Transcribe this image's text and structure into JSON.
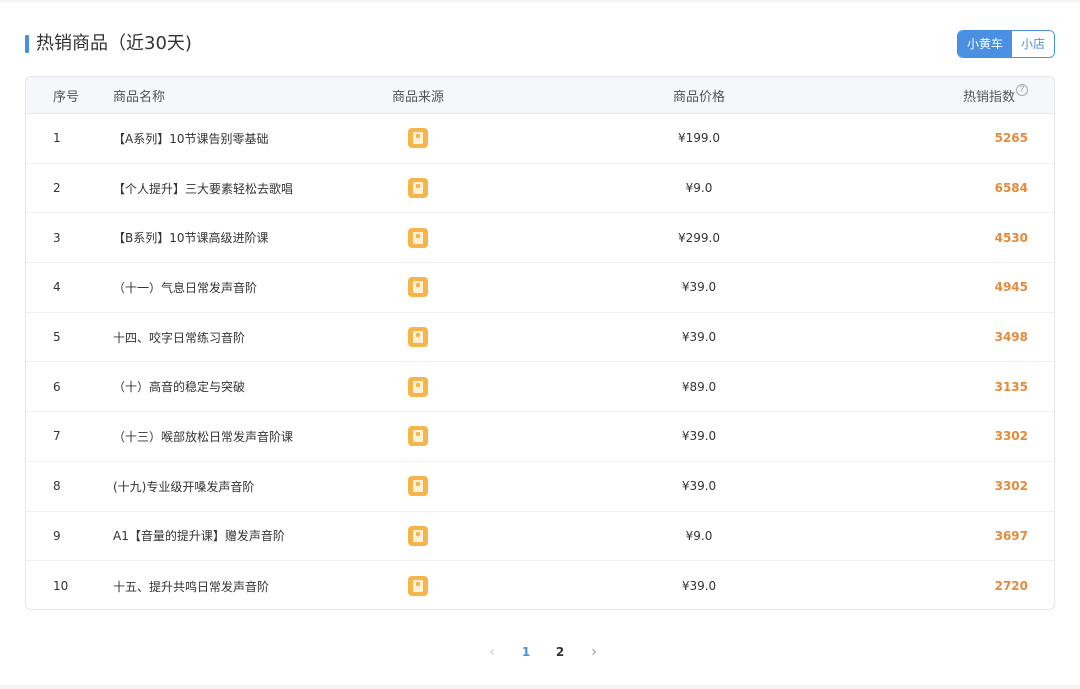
{
  "header": {
    "title": "热销商品（近30天)"
  },
  "toggle": {
    "options": [
      "小黄车",
      "小店"
    ],
    "selected": "小黄车"
  },
  "table": {
    "columns": {
      "index": "序号",
      "name": "商品名称",
      "source": "商品来源",
      "price": "商品价格",
      "heat": "热销指数"
    },
    "rows": [
      {
        "index": "1",
        "name": "【A系列】10节课告别零基础",
        "source_icon": "product-source-icon",
        "price": "¥199.0",
        "heat": "5265"
      },
      {
        "index": "2",
        "name": "【个人提升】三大要素轻松去歌唱",
        "source_icon": "product-source-icon",
        "price": "¥9.0",
        "heat": "6584"
      },
      {
        "index": "3",
        "name": "【B系列】10节课高级进阶课",
        "source_icon": "product-source-icon",
        "price": "¥299.0",
        "heat": "4530"
      },
      {
        "index": "4",
        "name": "（十一）气息日常发声音阶",
        "source_icon": "product-source-icon",
        "price": "¥39.0",
        "heat": "4945"
      },
      {
        "index": "5",
        "name": "十四、咬字日常练习音阶",
        "source_icon": "product-source-icon",
        "price": "¥39.0",
        "heat": "3498"
      },
      {
        "index": "6",
        "name": "（十）高音的稳定与突破",
        "source_icon": "product-source-icon",
        "price": "¥89.0",
        "heat": "3135"
      },
      {
        "index": "7",
        "name": "（十三）喉部放松日常发声音阶课",
        "source_icon": "product-source-icon",
        "price": "¥39.0",
        "heat": "3302"
      },
      {
        "index": "8",
        "name": "(十九)专业级开嗓发声音阶",
        "source_icon": "product-source-icon",
        "price": "¥39.0",
        "heat": "3302"
      },
      {
        "index": "9",
        "name": "A1【音量的提升课】赠发声音阶",
        "source_icon": "product-source-icon",
        "price": "¥9.0",
        "heat": "3697"
      },
      {
        "index": "10",
        "name": "十五、提升共鸣日常发声音阶",
        "source_icon": "product-source-icon",
        "price": "¥39.0",
        "heat": "2720"
      }
    ]
  },
  "pagination": {
    "prev_icon": "chevron-left-icon",
    "next_icon": "chevron-right-icon",
    "pages": [
      "1",
      "2"
    ],
    "current": "1"
  },
  "colors": {
    "accent": "#4a90e2",
    "heat": "#e58a3a",
    "source_icon": "#f5b54a"
  }
}
